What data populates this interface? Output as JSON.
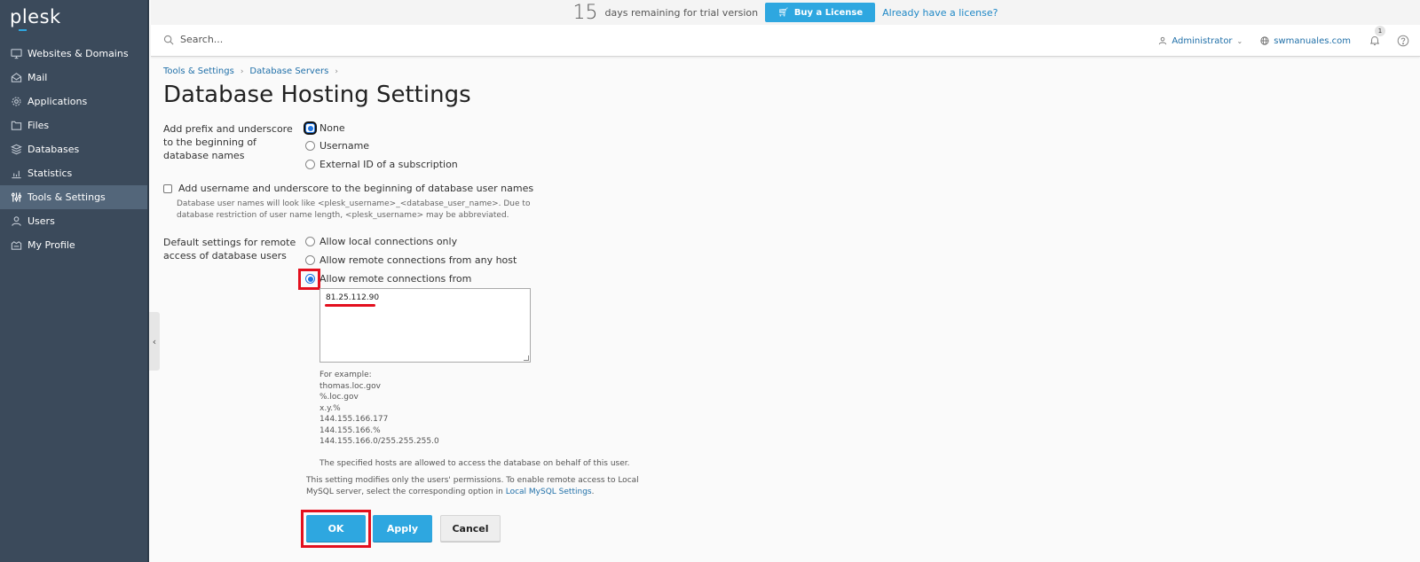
{
  "brand": {
    "logo": "plesk"
  },
  "sidebar": {
    "items": [
      {
        "label": "Websites & Domains",
        "icon": "monitor-icon",
        "active": false
      },
      {
        "label": "Mail",
        "icon": "envelope-icon",
        "active": false
      },
      {
        "label": "Applications",
        "icon": "gear-icon",
        "active": false
      },
      {
        "label": "Files",
        "icon": "folder-icon",
        "active": false
      },
      {
        "label": "Databases",
        "icon": "layers-icon",
        "active": false
      },
      {
        "label": "Statistics",
        "icon": "bar-chart-icon",
        "active": false
      },
      {
        "label": "Tools & Settings",
        "icon": "sliders-icon",
        "active": true
      },
      {
        "label": "Users",
        "icon": "user-icon",
        "active": false
      },
      {
        "label": "My Profile",
        "icon": "profile-icon",
        "active": false
      }
    ],
    "collapse_glyph": "‹"
  },
  "trial": {
    "days": "15",
    "text": "days remaining for trial version",
    "buy_label": "Buy a License",
    "license_link": "Already have a license?"
  },
  "header": {
    "search_placeholder": "Search...",
    "user_label": "Administrator",
    "domain_label": "swmanuales.com",
    "notification_count": "1"
  },
  "breadcrumb": [
    {
      "label": "Tools & Settings"
    },
    {
      "label": "Database Servers"
    }
  ],
  "page": {
    "title": "Database Hosting Settings"
  },
  "form": {
    "prefix": {
      "label": "Add prefix and underscore to the beginning of database names",
      "options": [
        {
          "label": "None",
          "checked": true
        },
        {
          "label": "Username",
          "checked": false
        },
        {
          "label": "External ID of a subscription",
          "checked": false
        }
      ]
    },
    "username_prefix": {
      "label": "Add username and underscore to the beginning of database user names",
      "checked": false,
      "hint_line1": "Database user names will look like <plesk_username>_<database_user_name>. Due to",
      "hint_line2": "database restriction of user name length, <plesk_username> may be abbreviated."
    },
    "remote_access": {
      "label": "Default settings for remote access of database users",
      "options": [
        {
          "label": "Allow local connections only",
          "checked": false
        },
        {
          "label": "Allow remote connections from any host",
          "checked": false
        },
        {
          "label": "Allow remote connections from",
          "checked": true
        }
      ],
      "hosts_value": "81.25.112.90",
      "examples_title": "For example:",
      "examples": [
        "thomas.loc.gov",
        "%.loc.gov",
        "x.y.%",
        "144.155.166.177",
        "144.155.166.%",
        "144.155.166.0/255.255.255.0"
      ],
      "hosts_note": "The specified hosts are allowed to access the database on behalf of this user.",
      "note_line1": "This setting modifies only the users' permissions. To enable remote access to Local",
      "note_line2_prefix": "MySQL server, select the corresponding option in ",
      "note_link": "Local MySQL Settings",
      "note_suffix": "."
    }
  },
  "buttons": {
    "ok": "OK",
    "apply": "Apply",
    "cancel": "Cancel"
  },
  "annotation_color": "#e3101e",
  "accent_color": "#2ea7e0"
}
